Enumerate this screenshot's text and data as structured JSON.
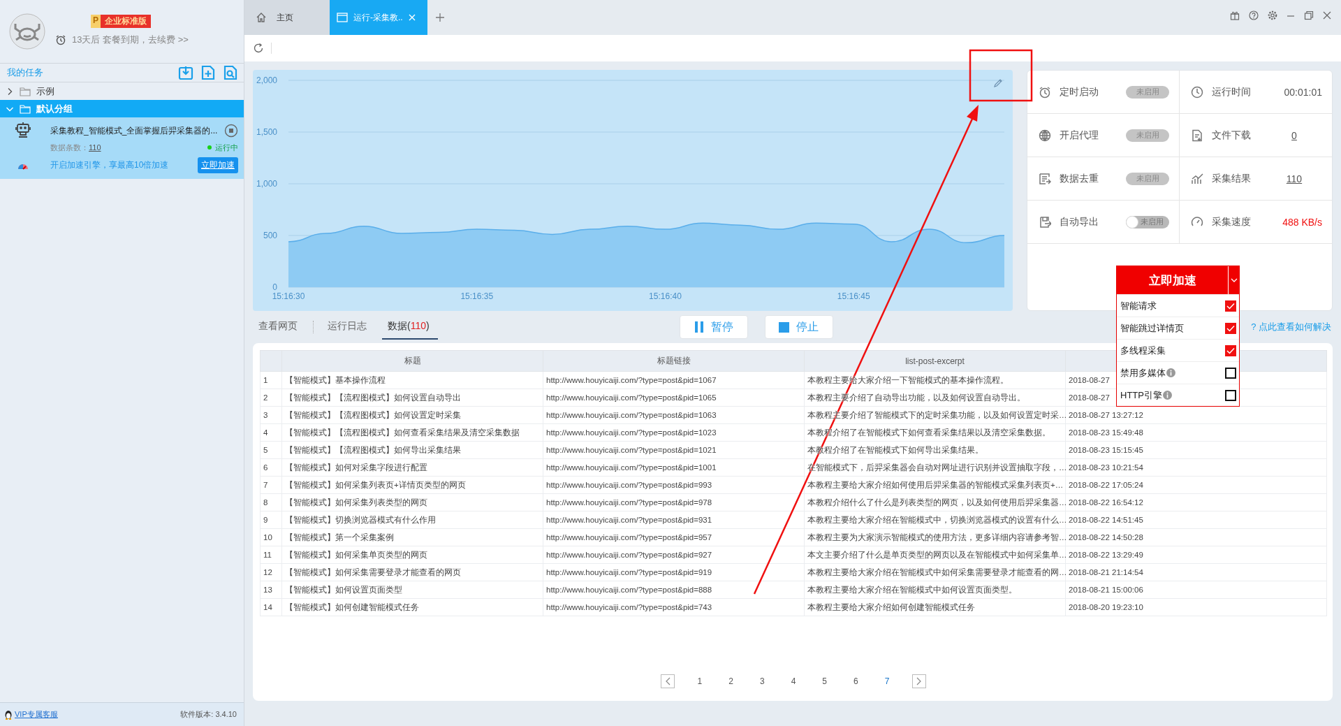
{
  "account": {
    "plan": {
      "letter": "P",
      "name": "企业标准版"
    },
    "expiry": "13天后 套餐到期，去续费 >>"
  },
  "sidebar": {
    "title": "我的任务",
    "tree": [
      {
        "label": "示例",
        "expanded": false,
        "selected": false
      },
      {
        "label": "默认分组",
        "expanded": true,
        "selected": true,
        "children": [
          {
            "kind": "task",
            "title": "采集教程_智能模式_全面掌握后羿采集器的...",
            "count_label": "数据条数：",
            "count": "110",
            "status": "运行中",
            "promo": "开启加速引擎，享最高10倍加速",
            "button": "立即加速"
          }
        ]
      }
    ],
    "footer": {
      "support": "VIP专属客服",
      "version": "软件版本: 3.4.10"
    }
  },
  "tabs": [
    {
      "kind": "home",
      "label": "主页",
      "selected": false
    },
    {
      "kind": "page",
      "label": "运行-采集教..",
      "selected": true
    }
  ],
  "chart": {
    "chart_data": {
      "type": "area",
      "categories": [
        "15:16:30",
        null,
        null,
        null,
        null,
        "15:16:35",
        null,
        null,
        null,
        null,
        "15:16:40",
        null,
        null,
        null,
        null,
        "15:16:45",
        null,
        null,
        null,
        null
      ],
      "series": [
        {
          "color": "#8ecbf3",
          "values": [
            440,
            520,
            590,
            520,
            530,
            560,
            550,
            510,
            560,
            590,
            560,
            620,
            600,
            560,
            620,
            610,
            440,
            560,
            430,
            500
          ]
        }
      ],
      "ylim": [
        0,
        2000
      ],
      "grid": true,
      "yticks": [
        {
          "value": 0,
          "label": "0"
        },
        {
          "value": 500,
          "label": "500"
        },
        {
          "value": 1000,
          "label": "1,000"
        },
        {
          "value": 1500,
          "label": "1,500"
        },
        {
          "value": 2000,
          "label": "2,000"
        }
      ]
    }
  },
  "stats": [
    {
      "kind": "toggle",
      "label": "定时启动",
      "state": "未启用",
      "on": false,
      "disabled": true
    },
    {
      "kind": "value",
      "label": "运行时间",
      "value": "00:01:01",
      "alert": false
    },
    {
      "kind": "toggle",
      "label": "开启代理",
      "state": "未启用",
      "on": false,
      "disabled": true
    },
    {
      "kind": "link",
      "label": "文件下载",
      "value": "0"
    },
    {
      "kind": "toggle",
      "label": "数据去重",
      "state": "未启用",
      "on": false,
      "disabled": true
    },
    {
      "kind": "link",
      "label": "采集结果",
      "value": "110"
    },
    {
      "kind": "toggle",
      "label": "自动导出",
      "state": "未启用",
      "on": false,
      "disabled": false
    },
    {
      "kind": "value",
      "label": "采集速度",
      "value": "488 KB/s",
      "alert": true
    }
  ],
  "boost": {
    "title": "立即加速",
    "options": [
      {
        "label": "智能请求",
        "checked": true,
        "info": false
      },
      {
        "label": "智能跳过详情页",
        "checked": true,
        "info": false
      },
      {
        "label": "多线程采集",
        "checked": true,
        "info": false
      },
      {
        "label": "禁用多媒体",
        "checked": false,
        "info": true
      },
      {
        "label": "HTTP引擎",
        "checked": false,
        "info": true
      }
    ]
  },
  "help_link": "? 点此查看如何解决",
  "view_tabs": [
    {
      "label": "查看网页",
      "selected": false
    },
    {
      "label": "运行日志",
      "selected": false
    },
    {
      "label": "数据(",
      "count": "110",
      "closing": ")",
      "selected": true
    }
  ],
  "actions": [
    {
      "kind": "pause",
      "label": "暂停"
    },
    {
      "kind": "stop",
      "label": "停止"
    }
  ],
  "table": {
    "columns": [
      {
        "kind": "index"
      },
      {
        "kind": "text",
        "label": "标题"
      },
      {
        "kind": "text",
        "label": "标题链接"
      },
      {
        "kind": "text",
        "label": "list-post-excerpt"
      },
      {
        "kind": "text"
      }
    ],
    "rows": [
      [
        "1",
        "【智能模式】基本操作流程",
        "http://www.houyicaiji.com/?type=post&pid=1067",
        "本教程主要给大家介绍一下智能模式的基本操作流程。",
        "2018-08-27"
      ],
      [
        "2",
        "【智能模式】【流程图模式】如何设置自动导出",
        "http://www.houyicaiji.com/?type=post&pid=1065",
        "本教程主要介绍了自动导出功能，以及如何设置自动导出。",
        "2018-08-27"
      ],
      [
        "3",
        "【智能模式】【流程图模式】如何设置定时采集",
        "http://www.houyicaiji.com/?type=post&pid=1063",
        "本教程主要介绍了智能模式下的定时采集功能，以及如何设置定时采…",
        "2018-08-27 13:27:12"
      ],
      [
        "4",
        "【智能模式】【流程图模式】如何查看采集结果及清空采集数据",
        "http://www.houyicaiji.com/?type=post&pid=1023",
        "本教程介绍了在智能模式下如何查看采集结果以及清空采集数据。",
        "2018-08-23 15:49:48"
      ],
      [
        "5",
        "【智能模式】【流程图模式】如何导出采集结果",
        "http://www.houyicaiji.com/?type=post&pid=1021",
        "本教程介绍了在智能模式下如何导出采集结果。",
        "2018-08-23 15:15:45"
      ],
      [
        "6",
        "【智能模式】如何对采集字段进行配置",
        "http://www.houyicaiji.com/?type=post&pid=1001",
        "在智能模式下，后羿采集器会自动对网址进行识别并设置抽取字段，…",
        "2018-08-23 10:21:54"
      ],
      [
        "7",
        "【智能模式】如何采集列表页+详情页类型的网页",
        "http://www.houyicaiji.com/?type=post&pid=993",
        "本教程主要给大家介绍如何使用后羿采集器的智能模式采集列表页+…",
        "2018-08-22 17:05:24"
      ],
      [
        "8",
        "【智能模式】如何采集列表类型的网页",
        "http://www.houyicaiji.com/?type=post&pid=978",
        "本教程介绍什么了什么是列表类型的网页，以及如何使用后羿采集器…",
        "2018-08-22 16:54:12"
      ],
      [
        "9",
        "【智能模式】切换浏览器模式有什么作用",
        "http://www.houyicaiji.com/?type=post&pid=931",
        "本教程主要给大家介绍在智能模式中，切换浏览器模式的设置有什么…",
        "2018-08-22 14:51:45"
      ],
      [
        "10",
        "【智能模式】第一个采集案例",
        "http://www.houyicaiji.com/?type=post&pid=957",
        "本教程主要为大家演示智能模式的使用方法，更多详细内容请参考智…",
        "2018-08-22 14:50:28"
      ],
      [
        "11",
        "【智能模式】如何采集单页类型的网页",
        "http://www.houyicaiji.com/?type=post&pid=927",
        "本文主要介绍了什么是单页类型的网页以及在智能模式中如何采集单…",
        "2018-08-22 13:29:49"
      ],
      [
        "12",
        "【智能模式】如何采集需要登录才能查看的网页",
        "http://www.houyicaiji.com/?type=post&pid=919",
        "本教程主要给大家介绍在智能模式中如何采集需要登录才能查看的网…",
        "2018-08-21 21:14:54"
      ],
      [
        "13",
        "【智能模式】如何设置页面类型",
        "http://www.houyicaiji.com/?type=post&pid=888",
        "本教程主要给大家介绍在智能模式中如何设置页面类型。",
        "2018-08-21 15:00:06"
      ],
      [
        "14",
        "【智能模式】如何创建智能模式任务",
        "http://www.houyicaiji.com/?type=post&pid=743",
        "本教程主要给大家介绍如何创建智能模式任务",
        "2018-08-20 19:23:10"
      ]
    ]
  },
  "pagination": [
    {
      "label": "1",
      "selected": false
    },
    {
      "label": "2",
      "selected": false
    },
    {
      "label": "3",
      "selected": false
    },
    {
      "label": "4",
      "selected": false
    },
    {
      "label": "5",
      "selected": false
    },
    {
      "label": "6",
      "selected": false
    },
    {
      "label": "7",
      "selected": true
    }
  ]
}
